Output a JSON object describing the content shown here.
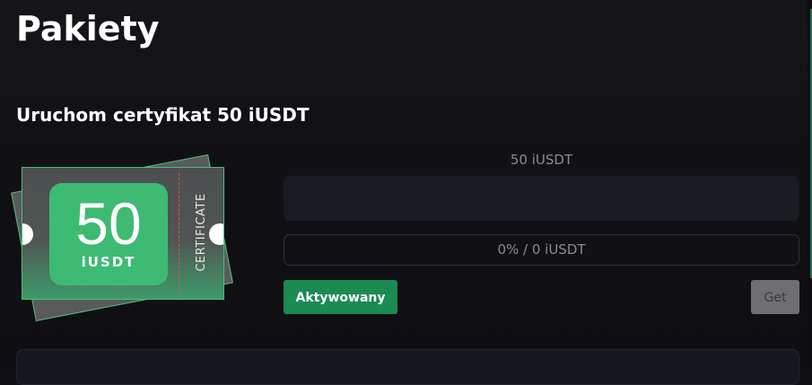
{
  "page": {
    "title": "Pakiety"
  },
  "package": {
    "title": "Uruchom certyfikat 50 iUSDT",
    "amount_label": "50 iUSDT",
    "amount_input_value": "",
    "progress": {
      "percent": 0,
      "text": "0% / 0 iUSDT"
    },
    "activate_button_label": "Aktywowany",
    "get_button_label": "Get"
  },
  "certificate": {
    "number": "50",
    "unit": "iUSDT",
    "side_text": "CERTIFICATE"
  },
  "colors": {
    "accent_green": "#1b8a53",
    "badge_green": "#3dbb72",
    "background": "#111115",
    "disabled_gray": "#6f6f72"
  }
}
